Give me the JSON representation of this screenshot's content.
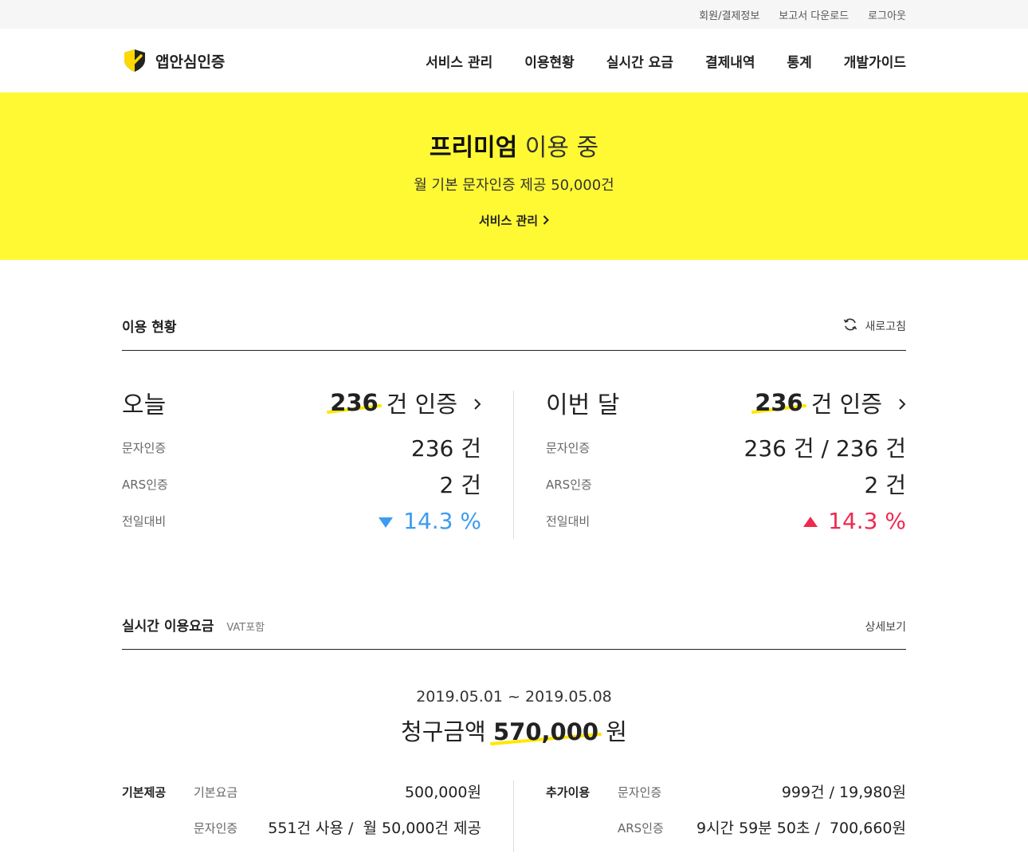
{
  "topbar": {
    "links": [
      "회원/결제정보",
      "보고서 다운로드",
      "로그아웃"
    ]
  },
  "header": {
    "logo_text": "앱안심인증",
    "nav": [
      "서비스 관리",
      "이용현황",
      "실시간 요금",
      "결제내역",
      "통계",
      "개발가이드"
    ]
  },
  "hero": {
    "plan_name": "프리미엄",
    "plan_suffix": "이용 중",
    "description": "월 기본 문자인증 제공 50,000건",
    "link_label": "서비스 관리"
  },
  "usage": {
    "title": "이용 현황",
    "refresh_label": "새로고침",
    "today": {
      "label": "오늘",
      "total_num": "236",
      "total_suffix": "건 인증",
      "sms_label": "문자인증",
      "sms_value": "236 건",
      "ars_label": "ARS인증",
      "ars_value": "2 건",
      "compare_label": "전일대비",
      "compare_value": "14.3 %",
      "compare_direction": "down"
    },
    "month": {
      "label": "이번 달",
      "total_num": "236",
      "total_suffix": "건 인증",
      "sms_label": "문자인증",
      "sms_value": "236 건 / 236 건",
      "ars_label": "ARS인증",
      "ars_value": "2 건",
      "compare_label": "전일대비",
      "compare_value": "14.3 %",
      "compare_direction": "up"
    }
  },
  "billing": {
    "title": "실시간 이용요금",
    "vat_note": "VAT포함",
    "detail_label": "상세보기",
    "period": "2019.05.01 ~ 2019.05.08",
    "amount_prefix": "청구금액",
    "amount_value": "570,000",
    "amount_unit": "원",
    "basic": {
      "group_label": "기본제공",
      "rows": [
        {
          "label": "기본요금",
          "value": "500,000원"
        },
        {
          "label": "문자인증",
          "value": "551건 사용 /  월 50,000건 제공"
        }
      ]
    },
    "extra": {
      "group_label": "추가이용",
      "rows": [
        {
          "label": "문자인증",
          "value": "999건 / 19,980원"
        },
        {
          "label": "ARS인증",
          "value": "9시간 59분 50초 /  700,660원"
        }
      ]
    }
  },
  "colors": {
    "accent_yellow": "#fff933",
    "down_blue": "#3d9bf0",
    "up_red": "#ef2a4f"
  }
}
